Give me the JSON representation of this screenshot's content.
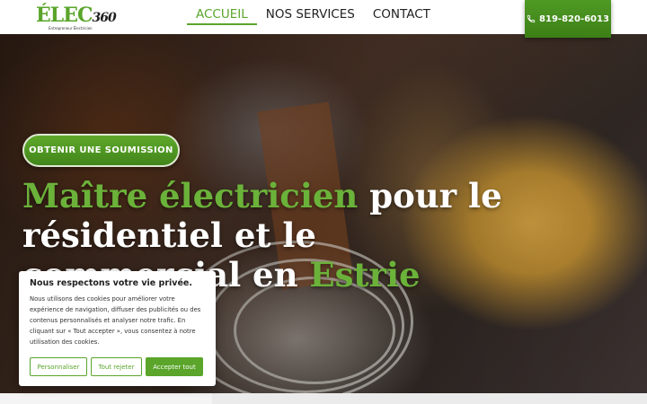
{
  "brand": {
    "logo_main": "ÉLEC",
    "logo_suffix": "360",
    "logo_tagline": "Entrepreneur Électricien"
  },
  "nav": {
    "items": [
      {
        "label": "ACCUEIL",
        "active": true
      },
      {
        "label": "NOS SERVICES",
        "active": false
      },
      {
        "label": "CONTACT",
        "active": false
      }
    ]
  },
  "phone": {
    "number": "819-820-6013",
    "icon": "phone-icon"
  },
  "hero": {
    "cta_label": "OBTENIR UNE SOUMISSION",
    "title_green_1": "Maître électricien",
    "title_white_1": " pour le résidentiel et le commercial en ",
    "title_green_2": "Estrie"
  },
  "cookie": {
    "title": "Nous respectons votre vie privée.",
    "text": "Nous utilisons des cookies pour améliorer votre expérience de navigation, diffuser des publicités ou des contenus personnalisés et analyser notre trafic. En cliquant sur « Tout accepter », vous consentez à notre utilisation des cookies.",
    "btn_customize": "Personnaliser",
    "btn_reject": "Tout rejeter",
    "btn_accept": "Accepter tout"
  },
  "colors": {
    "accent_green": "#5aa52a",
    "title_green": "#6bb23a"
  }
}
